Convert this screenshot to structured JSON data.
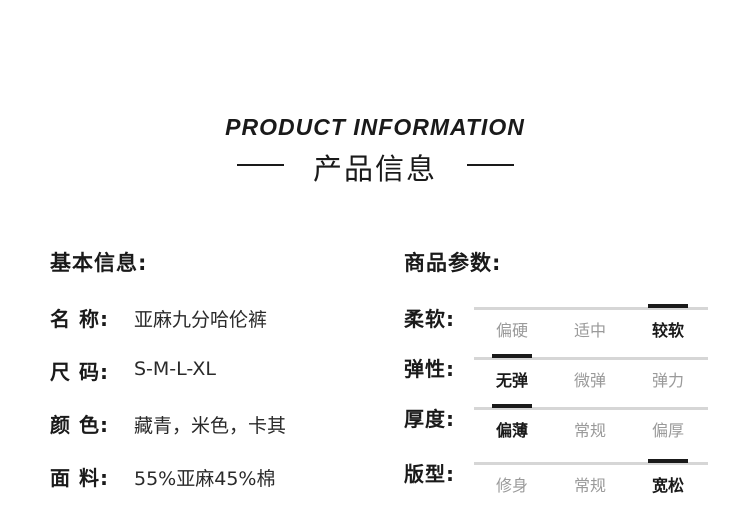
{
  "header": {
    "title_en": "PRODUCT INFORMATION",
    "title_cn": "产品信息"
  },
  "basic": {
    "heading": "基本信息:",
    "rows": [
      {
        "key": "名 称:",
        "value": "亚麻九分哈伦裤"
      },
      {
        "key": "尺 码:",
        "value": "S-M-L-XL"
      },
      {
        "key": "颜 色:",
        "value": "藏青，米色，卡其"
      },
      {
        "key": "面 料:",
        "value": "55%亚麻45%棉"
      }
    ]
  },
  "params": {
    "heading": "商品参数:",
    "rows": [
      {
        "key": "柔软:",
        "options": [
          "偏硬",
          "适中",
          "较软"
        ],
        "selected": 2
      },
      {
        "key": "弹性:",
        "options": [
          "无弹",
          "微弹",
          "弹力"
        ],
        "selected": 0
      },
      {
        "key": "厚度:",
        "options": [
          "偏薄",
          "常规",
          "偏厚"
        ],
        "selected": 0
      },
      {
        "key": "版型:",
        "options": [
          "修身",
          "常规",
          "宽松"
        ],
        "selected": 2
      }
    ]
  }
}
